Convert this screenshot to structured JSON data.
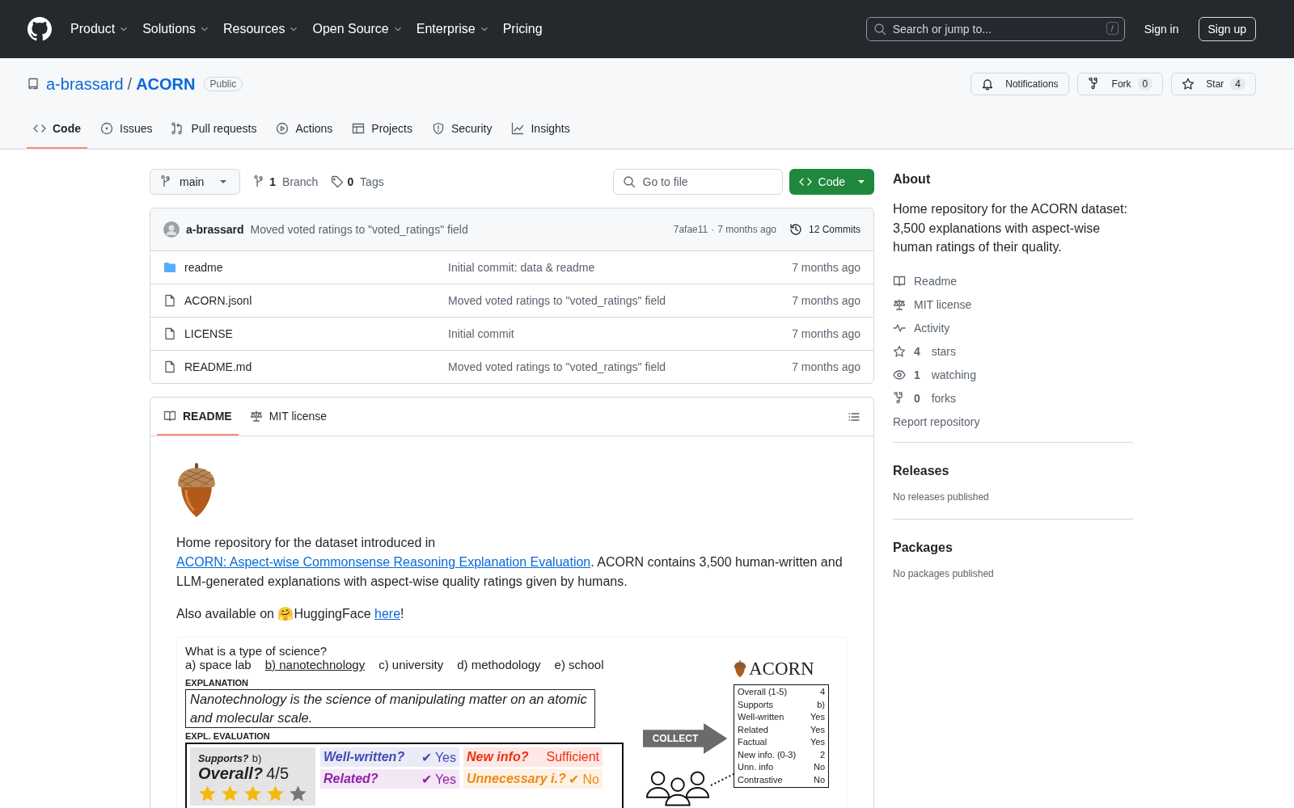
{
  "header": {
    "nav": [
      {
        "label": "Product",
        "dropdown": true
      },
      {
        "label": "Solutions",
        "dropdown": true
      },
      {
        "label": "Resources",
        "dropdown": true
      },
      {
        "label": "Open Source",
        "dropdown": true
      },
      {
        "label": "Enterprise",
        "dropdown": true
      },
      {
        "label": "Pricing",
        "dropdown": false
      }
    ],
    "search": {
      "placeholder": "Search or jump to...",
      "shortcut": "/"
    },
    "sign_in": "Sign in",
    "sign_up": "Sign up"
  },
  "repo": {
    "owner": "a-brassard",
    "separator": "/",
    "name": "ACORN",
    "visibility": "Public",
    "actions": [
      {
        "label": "Notifications",
        "kind": "bell"
      },
      {
        "label": "Fork",
        "kind": "fork",
        "count": "0"
      },
      {
        "label": "Star",
        "kind": "star",
        "count": "4"
      }
    ]
  },
  "tabs": [
    {
      "label": "Code",
      "kind": "code",
      "selected": true
    },
    {
      "label": "Issues",
      "kind": "issue",
      "selected": false
    },
    {
      "label": "Pull requests",
      "kind": "pr",
      "selected": false
    },
    {
      "label": "Actions",
      "kind": "play",
      "selected": false
    },
    {
      "label": "Projects",
      "kind": "table",
      "selected": false
    },
    {
      "label": "Security",
      "kind": "shield",
      "selected": false
    },
    {
      "label": "Insights",
      "kind": "graph",
      "selected": false
    }
  ],
  "toolbar": {
    "branch": "main",
    "branches": {
      "count": "1",
      "label": "Branch"
    },
    "tags": {
      "count": "0",
      "label": "Tags"
    },
    "go_to_file": {
      "placeholder": "Go to file"
    },
    "code_button": "Code"
  },
  "latest_commit": {
    "author": "a-brassard",
    "message": "Moved voted ratings to \"voted_ratings\" field",
    "hash": "7afae11",
    "separator": "·",
    "time": "7 months ago",
    "commits": "12 Commits"
  },
  "files": [
    {
      "name": "readme",
      "kind": "folder",
      "message": "Initial commit: data & readme",
      "time": "7 months ago"
    },
    {
      "name": "ACORN.jsonl",
      "kind": "file",
      "message": "Moved voted ratings to \"voted_ratings\" field",
      "time": "7 months ago"
    },
    {
      "name": "LICENSE",
      "kind": "file",
      "message": "Initial commit",
      "time": "7 months ago"
    },
    {
      "name": "README.md",
      "kind": "file",
      "message": "Moved voted ratings to \"voted_ratings\" field",
      "time": "7 months ago"
    }
  ],
  "readme": {
    "tabs": [
      {
        "label": "README",
        "kind": "book",
        "selected": true
      },
      {
        "label": "MIT license",
        "kind": "law",
        "selected": false
      }
    ],
    "paragraphs": [
      {
        "before": "Home repository for the dataset introduced in ",
        "link": "ACORN: Aspect-wise Commonsense Reasoning Explanation Evaluation",
        "after": ". ACORN contains 3,500 human-written and LLM-generated explanations with aspect-wise quality ratings given by humans."
      },
      {
        "before": "Also available on 🤗HuggingFace ",
        "link": "here",
        "after": "!"
      }
    ],
    "figure": {
      "question": "What is a type of science?",
      "options": [
        {
          "text": "a) space lab",
          "correct": false
        },
        {
          "text": "b) nanotechnology",
          "correct": true
        },
        {
          "text": "c) university",
          "correct": false
        },
        {
          "text": "d) methodology",
          "correct": false
        },
        {
          "text": "e) school",
          "correct": false
        }
      ],
      "explanation_label": "EXPLANATION",
      "explanation": "Nanotechnology is the science of manipulating matter on an atomic and molecular scale.",
      "evaluation_label": "EXPL. EVALUATION",
      "supports_label": "Supports?",
      "supports_value": "b)",
      "overall_label": "Overall?",
      "overall_value": "4/5",
      "stars": 4,
      "aspects": [
        {
          "label": "Well-written?",
          "mark": "✔",
          "value": "Yes",
          "color": "#3f4bb3"
        },
        {
          "label": "New info?",
          "value": "Sufficient",
          "color": "#f0300f"
        },
        {
          "label": "Related?",
          "mark": "✔",
          "value": "Yes",
          "color": "#9020a8"
        },
        {
          "label": "Unnecessary i.?",
          "mark": "✔",
          "value": "No",
          "color": "#ee8a12"
        }
      ],
      "collect": "COLLECT",
      "brand": "ACORN",
      "summary": [
        {
          "name": "Overall (1-5)",
          "value": "4"
        },
        {
          "name": "Supports",
          "value": "b)"
        },
        {
          "name": "Well-written",
          "value": "Yes"
        },
        {
          "name": "Related",
          "value": "Yes"
        },
        {
          "name": "Factual",
          "value": "Yes"
        },
        {
          "name": "New info. (0-3)",
          "value": "2"
        },
        {
          "name": "Unn. info",
          "value": "No"
        },
        {
          "name": "Contrastive",
          "value": "No"
        }
      ]
    }
  },
  "sidebar": {
    "about": "About",
    "description": "Home repository for the ACORN dataset: 3,500 explanations with aspect-wise human ratings of their quality.",
    "links": [
      {
        "label": "Readme",
        "kind": "book"
      },
      {
        "label": "MIT license",
        "kind": "law"
      },
      {
        "label": "Activity",
        "kind": "pulse"
      },
      {
        "count": "4",
        "label": "stars",
        "kind": "star"
      },
      {
        "count": "1",
        "label": "watching",
        "kind": "eye"
      },
      {
        "count": "0",
        "label": "forks",
        "kind": "fork"
      }
    ],
    "report": "Report repository",
    "sections": [
      {
        "title": "Releases",
        "note": "No releases published"
      },
      {
        "title": "Packages",
        "note": "No packages published"
      }
    ]
  }
}
